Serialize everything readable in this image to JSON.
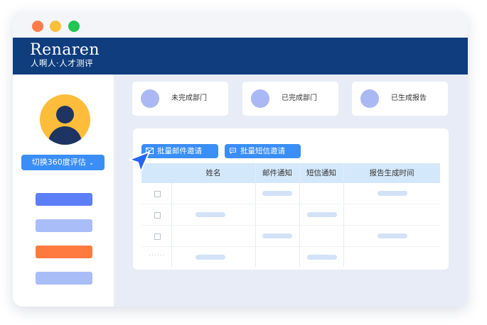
{
  "window": {
    "brand": {
      "name": "Renaren",
      "tagline": "人啊人·人才测评"
    }
  },
  "sidebar": {
    "switch_button": {
      "label": "切换360度评估",
      "icon": "chevron-down-icon"
    },
    "menu_colors": [
      "#5c7ef6",
      "#a9bdf8",
      "#ff7a3e",
      "#a9bdf8"
    ]
  },
  "summary_cards": [
    {
      "label": "未完成部门",
      "icon": "circle-icon"
    },
    {
      "label": "已完成部门",
      "icon": "circle-icon"
    },
    {
      "label": "已生成报告",
      "icon": "circle-icon"
    }
  ],
  "actions": {
    "email_invite": {
      "label": "批量邮件邀请",
      "icon": "mail-icon"
    },
    "sms_invite": {
      "label": "批量短信邀请",
      "icon": "message-icon"
    }
  },
  "table": {
    "headers": [
      "姓名",
      "邮件通知",
      "短信通知",
      "报告生成时间"
    ],
    "more_indicator": "......"
  },
  "colors": {
    "header_bg": "#0f3d7d",
    "accent": "#3a8ef6",
    "avatar_bg": "#fdbd3b",
    "placeholder": "#d3e2f6"
  }
}
